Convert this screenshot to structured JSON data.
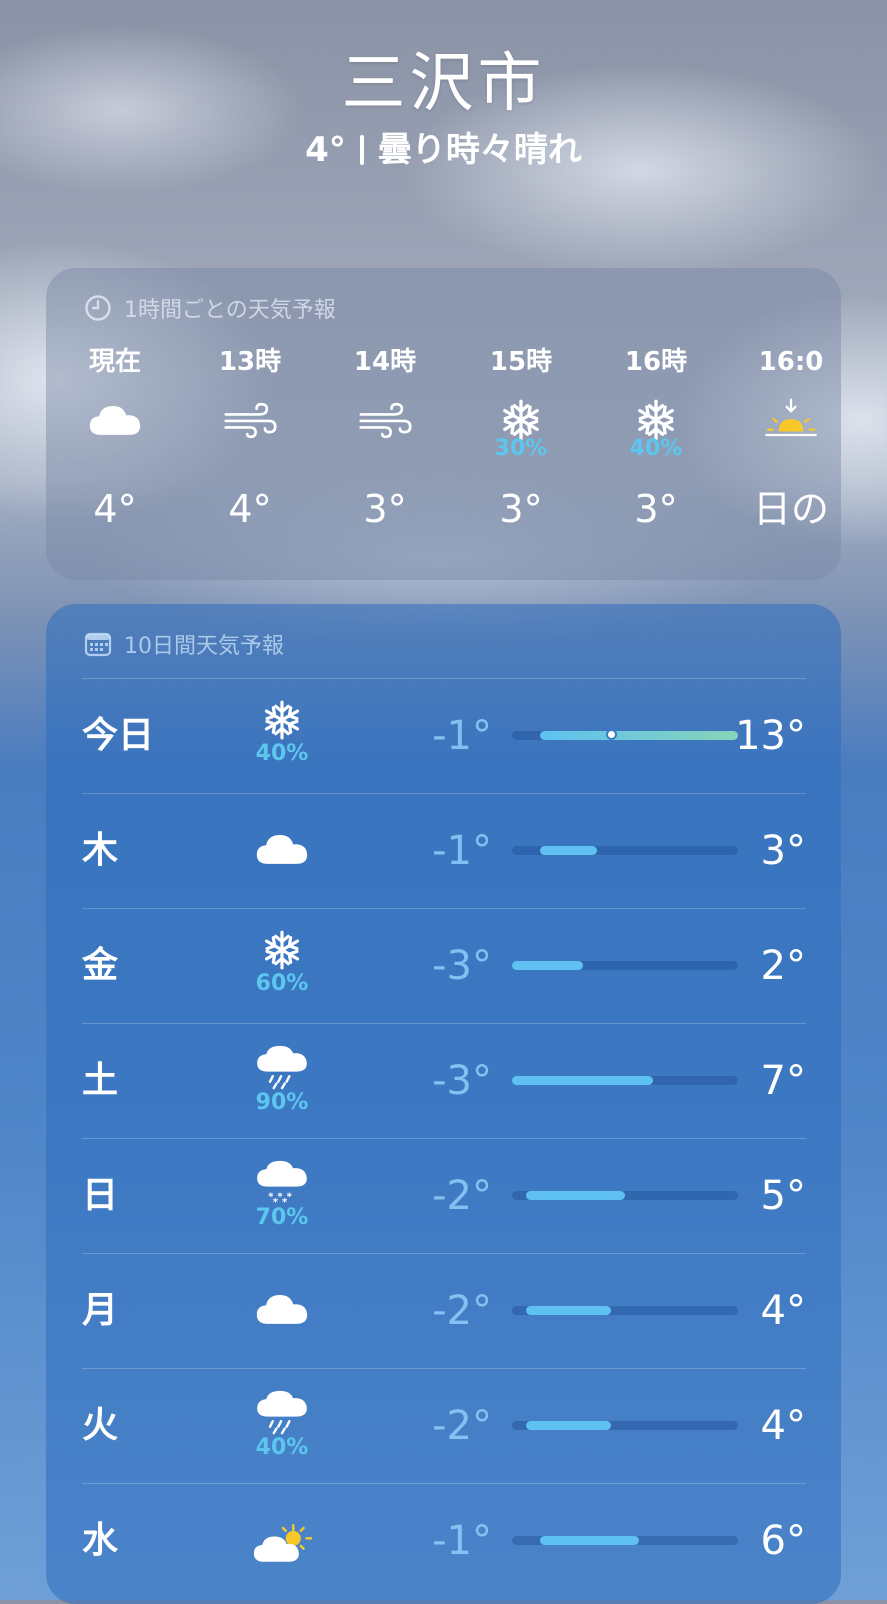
{
  "location": {
    "city": "三沢市",
    "current_temp": "4°",
    "condition": "曇り時々晴れ"
  },
  "hourly": {
    "title": "1時間ごとの天気予報",
    "hours": [
      {
        "time": "現在",
        "icon": "cloud-icon",
        "precip": "",
        "temp": "4°"
      },
      {
        "time": "13時",
        "icon": "wind-icon",
        "precip": "",
        "temp": "4°"
      },
      {
        "time": "14時",
        "icon": "wind-icon",
        "precip": "",
        "temp": "3°"
      },
      {
        "time": "15時",
        "icon": "snowflake-icon",
        "precip": "30%",
        "temp": "3°"
      },
      {
        "time": "16時",
        "icon": "snowflake-icon",
        "precip": "40%",
        "temp": "3°"
      },
      {
        "time": "16:0",
        "icon": "sunset-icon",
        "precip": "",
        "temp": "日の"
      }
    ]
  },
  "daily": {
    "title": "10日間天気予報",
    "range_min": -3,
    "range_max": 13,
    "current_temp": 4,
    "days": [
      {
        "day": "今日",
        "icon": "snowflake-icon",
        "precip": "40%",
        "low": "-1°",
        "high": "13°",
        "low_val": -1,
        "high_val": 13
      },
      {
        "day": "木",
        "icon": "cloud-icon",
        "precip": "",
        "low": "-1°",
        "high": "3°",
        "low_val": -1,
        "high_val": 3
      },
      {
        "day": "金",
        "icon": "snowflake-icon",
        "precip": "60%",
        "low": "-3°",
        "high": "2°",
        "low_val": -3,
        "high_val": 2
      },
      {
        "day": "土",
        "icon": "cloud-rain-icon",
        "precip": "90%",
        "low": "-3°",
        "high": "7°",
        "low_val": -3,
        "high_val": 7
      },
      {
        "day": "日",
        "icon": "cloud-snow-icon",
        "precip": "70%",
        "low": "-2°",
        "high": "5°",
        "low_val": -2,
        "high_val": 5
      },
      {
        "day": "月",
        "icon": "cloud-icon",
        "precip": "",
        "low": "-2°",
        "high": "4°",
        "low_val": -2,
        "high_val": 4
      },
      {
        "day": "火",
        "icon": "cloud-rain-icon",
        "precip": "40%",
        "low": "-2°",
        "high": "4°",
        "low_val": -2,
        "high_val": 4
      },
      {
        "day": "水",
        "icon": "cloud-sun-icon",
        "precip": "",
        "low": "-1°",
        "high": "6°",
        "low_val": -1,
        "high_val": 6
      }
    ]
  }
}
